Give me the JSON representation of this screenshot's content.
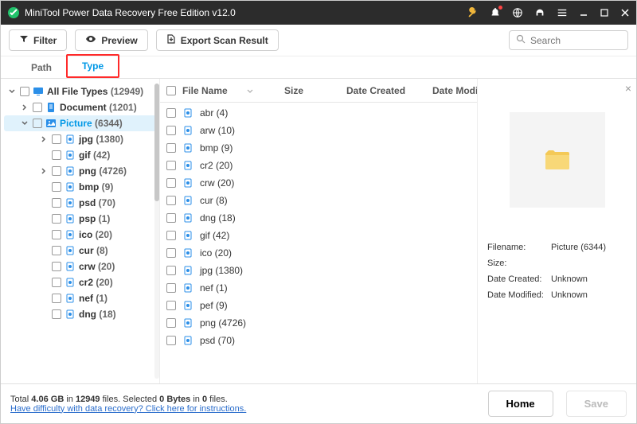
{
  "title": "MiniTool Power Data Recovery Free Edition v12.0",
  "toolbar": {
    "filter": "Filter",
    "preview": "Preview",
    "export": "Export Scan Result"
  },
  "search_placeholder": "Search",
  "tabs": {
    "path": "Path",
    "type": "Type"
  },
  "tree": {
    "root": {
      "label": "All File Types",
      "count": "(12949)"
    },
    "doc": {
      "label": "Document",
      "count": "(1201)"
    },
    "pic": {
      "label": "Picture",
      "count": "(6344)"
    },
    "children": [
      {
        "label": "jpg",
        "count": "(1380)",
        "expandable": true
      },
      {
        "label": "gif",
        "count": "(42)",
        "expandable": false
      },
      {
        "label": "png",
        "count": "(4726)",
        "expandable": true
      },
      {
        "label": "bmp",
        "count": "(9)",
        "expandable": false
      },
      {
        "label": "psd",
        "count": "(70)",
        "expandable": false
      },
      {
        "label": "psp",
        "count": "(1)",
        "expandable": false
      },
      {
        "label": "ico",
        "count": "(20)",
        "expandable": false
      },
      {
        "label": "cur",
        "count": "(8)",
        "expandable": false
      },
      {
        "label": "crw",
        "count": "(20)",
        "expandable": false
      },
      {
        "label": "cr2",
        "count": "(20)",
        "expandable": false
      },
      {
        "label": "nef",
        "count": "(1)",
        "expandable": false
      },
      {
        "label": "dng",
        "count": "(18)",
        "expandable": false
      }
    ]
  },
  "list": {
    "headers": {
      "name": "File Name",
      "size": "Size",
      "date_created": "Date Created",
      "date_modified": "Date Modif"
    },
    "items": [
      {
        "name": "abr",
        "count": "(4)"
      },
      {
        "name": "arw",
        "count": "(10)"
      },
      {
        "name": "bmp",
        "count": "(9)"
      },
      {
        "name": "cr2",
        "count": "(20)"
      },
      {
        "name": "crw",
        "count": "(20)"
      },
      {
        "name": "cur",
        "count": "(8)"
      },
      {
        "name": "dng",
        "count": "(18)"
      },
      {
        "name": "gif",
        "count": "(42)"
      },
      {
        "name": "ico",
        "count": "(20)"
      },
      {
        "name": "jpg",
        "count": "(1380)"
      },
      {
        "name": "nef",
        "count": "(1)"
      },
      {
        "name": "pef",
        "count": "(9)"
      },
      {
        "name": "png",
        "count": "(4726)"
      },
      {
        "name": "psd",
        "count": "(70)"
      }
    ]
  },
  "preview": {
    "filename_label": "Filename:",
    "size_label": "Size:",
    "date_created_label": "Date Created:",
    "date_modified_label": "Date Modified:",
    "filename": "Picture (6344)",
    "size": "",
    "date_created": "Unknown",
    "date_modified": "Unknown"
  },
  "footer": {
    "total_prefix": "Total ",
    "total_size": "4.06 GB",
    "in": " in ",
    "total_files": "12949",
    "files_word": " files.   ",
    "selected_prefix": "Selected ",
    "selected_size": "0 Bytes",
    "selected_in": " in ",
    "selected_files": "0",
    "selected_files_word": " files.",
    "help_link": "Have difficulty with data recovery? Click here for instructions.",
    "home": "Home",
    "save": "Save"
  }
}
